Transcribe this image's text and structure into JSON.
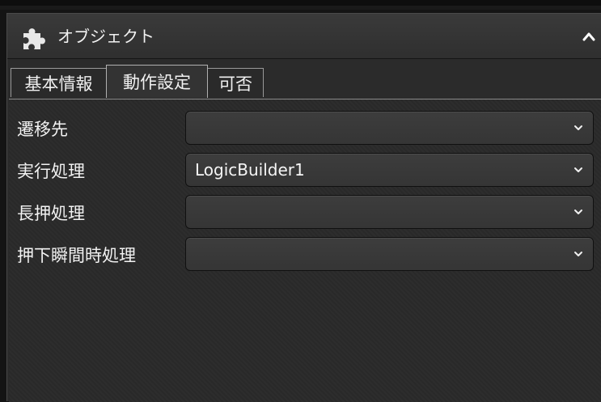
{
  "panel": {
    "title": "オブジェクト",
    "icon": "puzzle-icon",
    "collapse_icon": "chevron-up-icon"
  },
  "tabs": [
    {
      "label": "基本情報",
      "active": false
    },
    {
      "label": "動作設定",
      "active": true
    },
    {
      "label": "可否",
      "active": false
    }
  ],
  "fields": [
    {
      "label": "遷移先",
      "value": ""
    },
    {
      "label": "実行処理",
      "value": "LogicBuilder1"
    },
    {
      "label": "長押処理",
      "value": ""
    },
    {
      "label": "押下瞬間時処理",
      "value": ""
    }
  ],
  "colors": {
    "background": "#2b2b2b",
    "header": "#363636",
    "text": "#f2f2f2"
  }
}
